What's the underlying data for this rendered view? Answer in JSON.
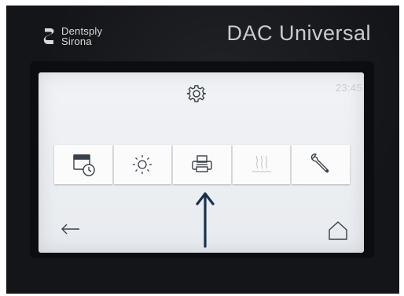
{
  "brand": {
    "line1": "Dentsply",
    "line2": "Sirona"
  },
  "model": "DAC Universal",
  "screen": {
    "clock": "23:45",
    "header_icon": "gear-icon",
    "tiles": [
      {
        "icon": "calendar-clock-icon",
        "state": "enabled"
      },
      {
        "icon": "brightness-icon",
        "state": "enabled"
      },
      {
        "icon": "printer-icon",
        "state": "enabled"
      },
      {
        "icon": "heating-icon",
        "state": "disabled"
      },
      {
        "icon": "wrench-icon",
        "state": "enabled"
      }
    ],
    "nav": {
      "back_icon": "back-arrow-icon",
      "home_icon": "home-icon"
    }
  },
  "annotation": {
    "icon": "up-arrow-icon"
  },
  "colors": {
    "device": "#141518",
    "screen": "#eef0f3",
    "tile": "#fbfbfc",
    "annotation": "#17324f"
  }
}
